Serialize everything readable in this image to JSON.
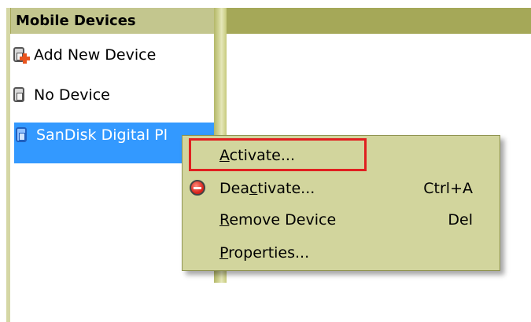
{
  "panel": {
    "title": "Mobile Devices"
  },
  "devices": [
    {
      "label": "Add New Device",
      "icon": "add-device-icon"
    },
    {
      "label": "No Device",
      "icon": "device-icon"
    },
    {
      "label": "SanDisk Digital Pl",
      "icon": "device-icon",
      "selected": true
    }
  ],
  "context_menu": {
    "items": [
      {
        "label_pre": "",
        "label_key": "A",
        "label_post": "ctivate...",
        "shortcut": "",
        "highlighted": true
      },
      {
        "label_pre": "Dea",
        "label_key": "c",
        "label_post": "tivate...",
        "shortcut": "Ctrl+A",
        "icon": "minus-icon"
      },
      {
        "label_pre": "",
        "label_key": "R",
        "label_post": "emove Device",
        "shortcut": "Del"
      },
      {
        "label_pre": "",
        "label_key": "P",
        "label_post": "roperties...",
        "shortcut": ""
      }
    ]
  },
  "colors": {
    "header_band": "#a5a858",
    "menu_background": "#d2d59d",
    "selection": "#3399ff",
    "highlight_border": "#e02020"
  }
}
